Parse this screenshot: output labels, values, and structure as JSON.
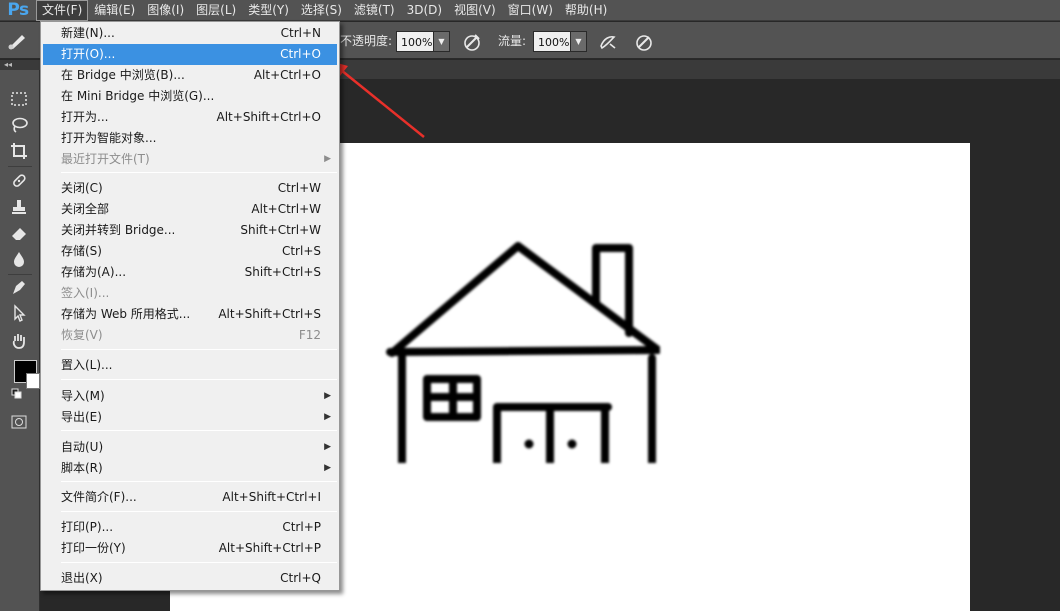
{
  "app": {
    "logo": "Ps"
  },
  "menubar": {
    "items": [
      "文件(F)",
      "编辑(E)",
      "图像(I)",
      "图层(L)",
      "类型(Y)",
      "选择(S)",
      "滤镜(T)",
      "3D(D)",
      "视图(V)",
      "窗口(W)",
      "帮助(H)"
    ]
  },
  "options": {
    "opacity_label": "不透明度:",
    "opacity_value": "100%",
    "flow_label": "流量:",
    "flow_value": "100%"
  },
  "panel_strip": {
    "collapse_glyph": "◂◂"
  },
  "file_menu": {
    "items": [
      {
        "label": "新建(N)...",
        "shortcut": "Ctrl+N"
      },
      {
        "label": "打开(O)...",
        "shortcut": "Ctrl+O"
      },
      {
        "label": "在 Bridge 中浏览(B)...",
        "shortcut": "Alt+Ctrl+O"
      },
      {
        "label": "在 Mini Bridge 中浏览(G)...",
        "shortcut": ""
      },
      {
        "label": "打开为...",
        "shortcut": "Alt+Shift+Ctrl+O"
      },
      {
        "label": "打开为智能对象...",
        "shortcut": ""
      },
      {
        "label": "最近打开文件(T)",
        "shortcut": ""
      },
      {
        "label": "关闭(C)",
        "shortcut": "Ctrl+W"
      },
      {
        "label": "关闭全部",
        "shortcut": "Alt+Ctrl+W"
      },
      {
        "label": "关闭并转到 Bridge...",
        "shortcut": "Shift+Ctrl+W"
      },
      {
        "label": "存储(S)",
        "shortcut": "Ctrl+S"
      },
      {
        "label": "存储为(A)...",
        "shortcut": "Shift+Ctrl+S"
      },
      {
        "label": "签入(I)...",
        "shortcut": ""
      },
      {
        "label": "存储为 Web 所用格式...",
        "shortcut": "Alt+Shift+Ctrl+S"
      },
      {
        "label": "恢复(V)",
        "shortcut": "F12"
      },
      {
        "label": "置入(L)...",
        "shortcut": ""
      },
      {
        "label": "导入(M)",
        "shortcut": ""
      },
      {
        "label": "导出(E)",
        "shortcut": ""
      },
      {
        "label": "自动(U)",
        "shortcut": ""
      },
      {
        "label": "脚本(R)",
        "shortcut": ""
      },
      {
        "label": "文件简介(F)...",
        "shortcut": "Alt+Shift+Ctrl+I"
      },
      {
        "label": "打印(P)...",
        "shortcut": "Ctrl+P"
      },
      {
        "label": "打印一份(Y)",
        "shortcut": "Alt+Shift+Ctrl+P"
      },
      {
        "label": "退出(X)",
        "shortcut": "Ctrl+Q"
      }
    ],
    "submenu_glyph": "▶"
  },
  "colors": {
    "menu_highlight": "#3b91e2",
    "arrow": "#e8302a",
    "foreground": "#000000",
    "background": "#ffffff"
  }
}
